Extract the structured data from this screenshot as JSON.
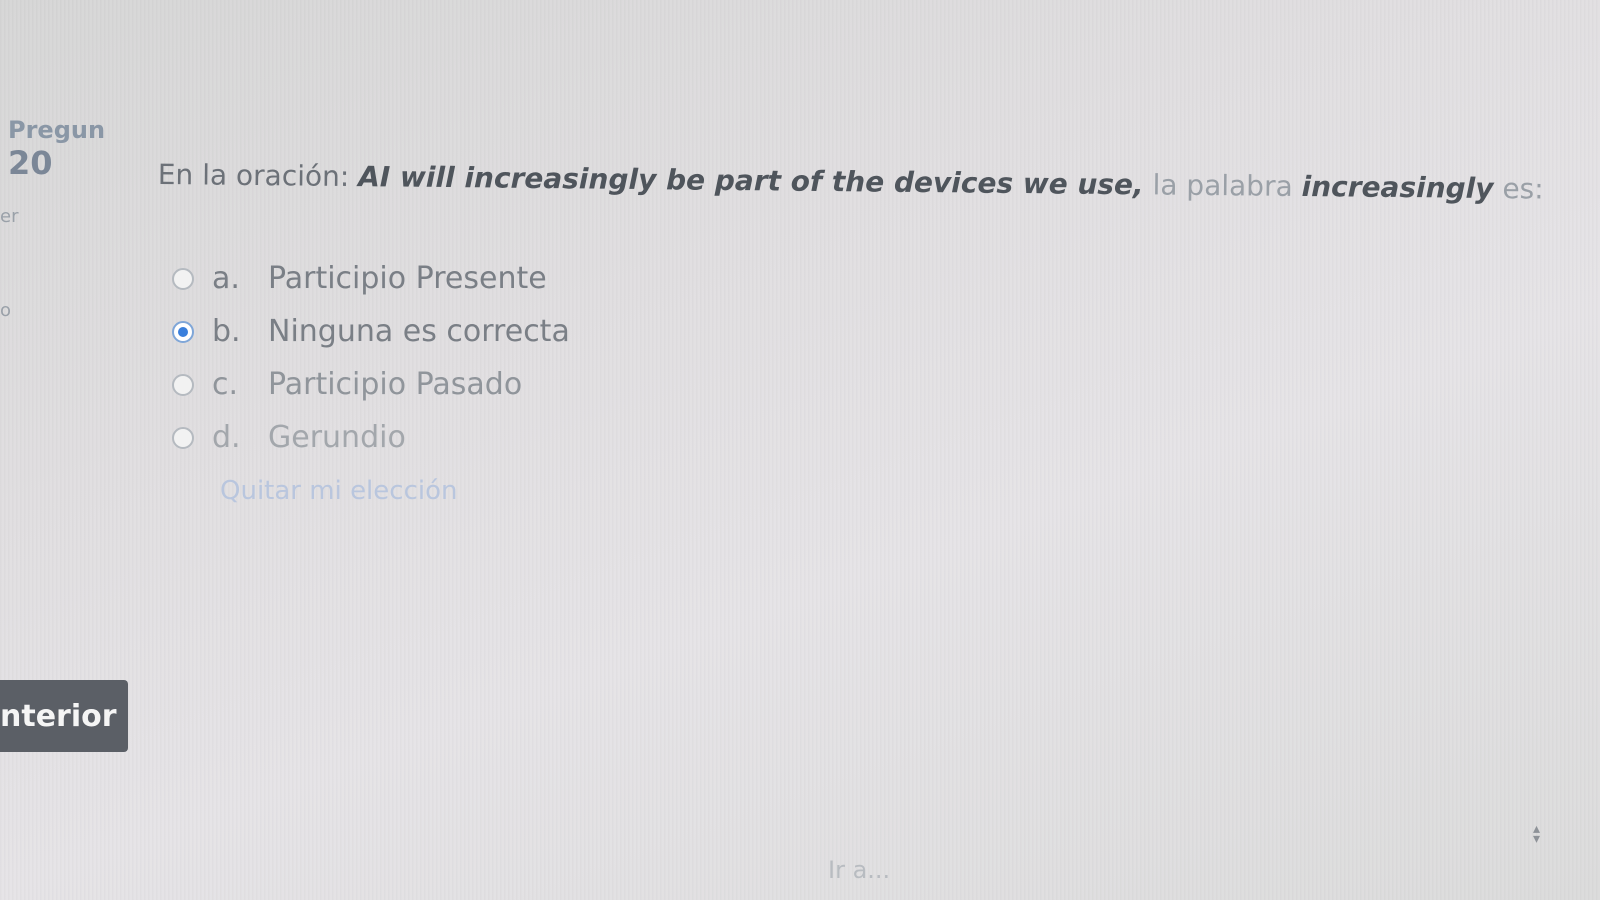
{
  "question_info": {
    "label": "Pregun",
    "number": "20",
    "side_fragment_1": "er",
    "side_fragment_2": "o"
  },
  "question": {
    "intro": "En la oración: ",
    "sentence": "AI will increasingly be part of the devices we use,",
    "middle": " la palabra ",
    "keyword": "increasingly",
    "end": " es:"
  },
  "answers": [
    {
      "letter": "a.",
      "text": "Participio Presente",
      "selected": false
    },
    {
      "letter": "b.",
      "text": "Ninguna es correcta",
      "selected": true
    },
    {
      "letter": "c.",
      "text": "Participio Pasado",
      "selected": false
    },
    {
      "letter": "d.",
      "text": "Gerundio",
      "selected": false
    }
  ],
  "clear_choice_label": "Quitar mi elección",
  "navigation": {
    "previous_label": "nterior",
    "goto_label": "Ir a..."
  },
  "colors": {
    "selected_radio": "#3a7fdc",
    "button_bg": "#5b5f66",
    "link": "#b9c6de"
  }
}
